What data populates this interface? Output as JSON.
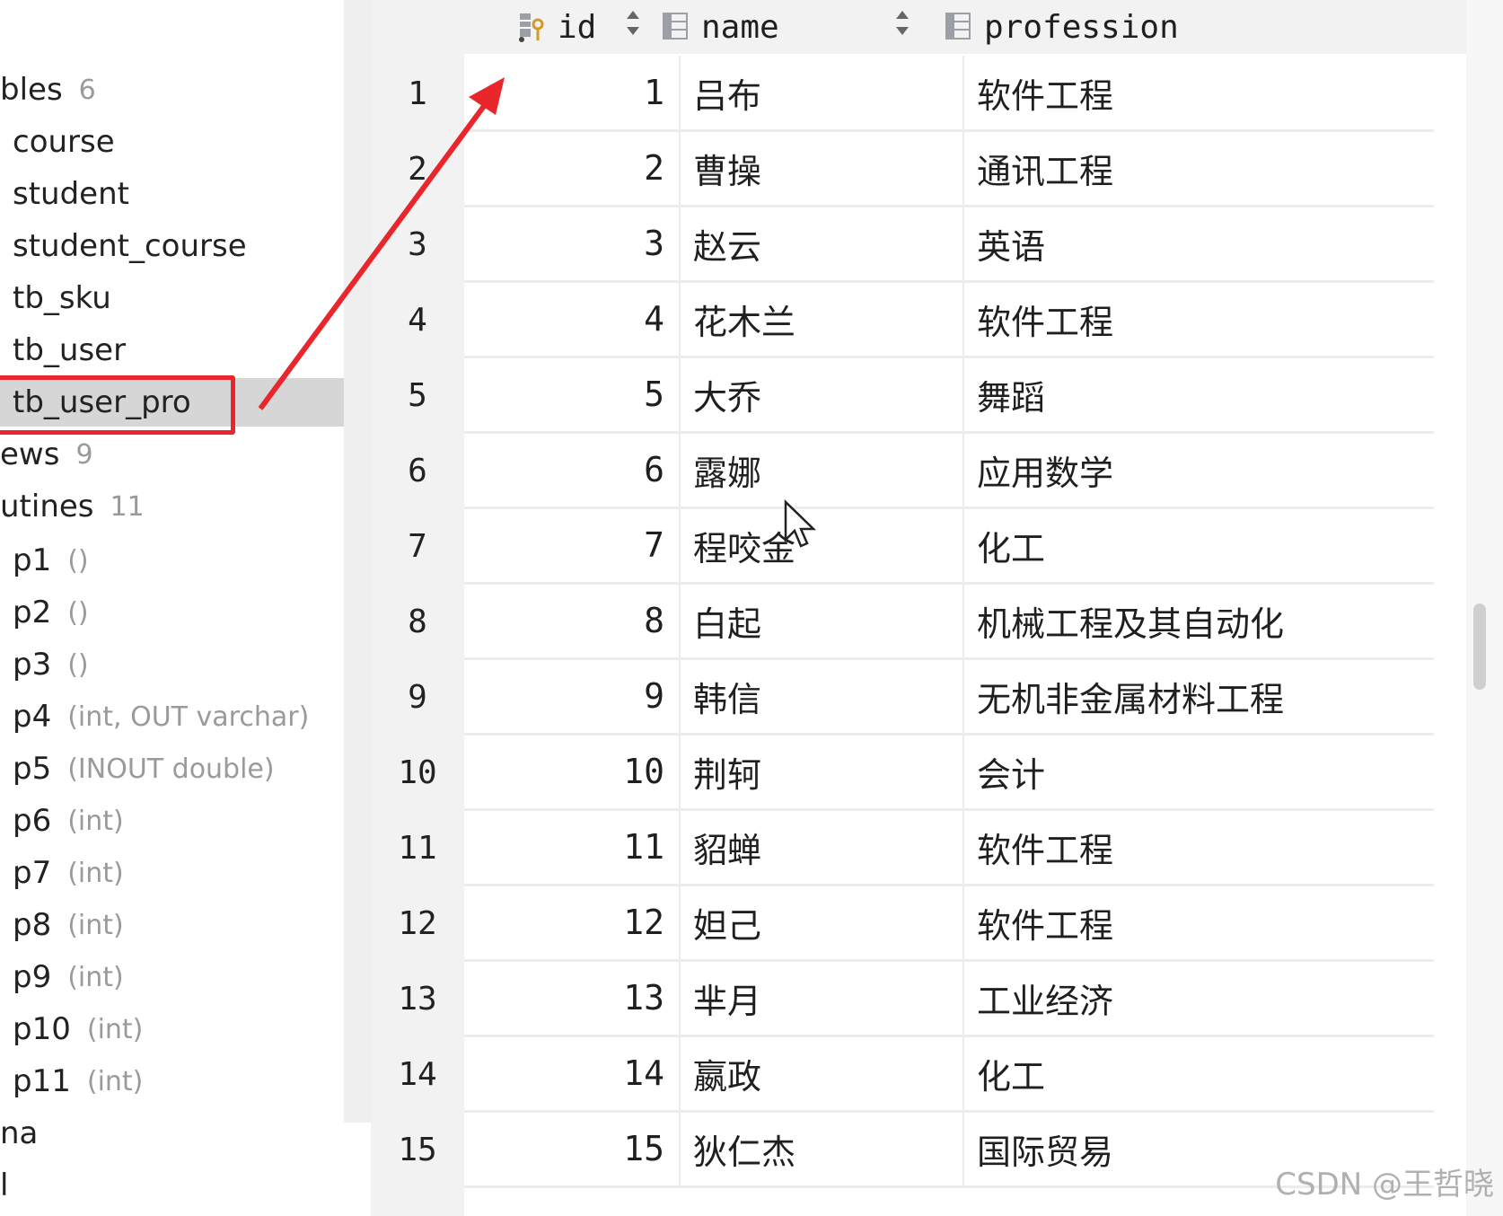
{
  "tree": {
    "items": [
      {
        "label": "bles",
        "meta": "6"
      },
      {
        "label": "course",
        "meta": ""
      },
      {
        "label": "student",
        "meta": ""
      },
      {
        "label": "student_course",
        "meta": ""
      },
      {
        "label": "tb_sku",
        "meta": ""
      },
      {
        "label": "tb_user",
        "meta": ""
      },
      {
        "label": "tb_user_pro",
        "meta": ""
      },
      {
        "label": "ews",
        "meta": "9"
      },
      {
        "label": "utines",
        "meta": "11"
      },
      {
        "label": "p1",
        "meta": "()"
      },
      {
        "label": "p2",
        "meta": "()"
      },
      {
        "label": "p3",
        "meta": "()"
      },
      {
        "label": "p4",
        "meta": "(int, OUT varchar)"
      },
      {
        "label": "p5",
        "meta": "(INOUT double)"
      },
      {
        "label": "p6",
        "meta": "(int)"
      },
      {
        "label": "p7",
        "meta": "(int)"
      },
      {
        "label": "p8",
        "meta": "(int)"
      },
      {
        "label": "p9",
        "meta": "(int)"
      },
      {
        "label": "p10",
        "meta": "(int)"
      },
      {
        "label": "p11",
        "meta": "(int)"
      },
      {
        "label": "na",
        "meta": ""
      },
      {
        "label": "l",
        "meta": ""
      }
    ]
  },
  "grid": {
    "columns": [
      {
        "name": "id",
        "icon": "primary-key-column-icon"
      },
      {
        "name": "name",
        "icon": "column-icon"
      },
      {
        "name": "profession",
        "icon": "column-icon"
      }
    ],
    "rows": [
      {
        "n": "1",
        "id": "1",
        "name": "吕布",
        "profession": "软件工程"
      },
      {
        "n": "2",
        "id": "2",
        "name": "曹操",
        "profession": "通讯工程"
      },
      {
        "n": "3",
        "id": "3",
        "name": "赵云",
        "profession": "英语"
      },
      {
        "n": "4",
        "id": "4",
        "name": "花木兰",
        "profession": "软件工程"
      },
      {
        "n": "5",
        "id": "5",
        "name": "大乔",
        "profession": "舞蹈"
      },
      {
        "n": "6",
        "id": "6",
        "name": "露娜",
        "profession": "应用数学"
      },
      {
        "n": "7",
        "id": "7",
        "name": "程咬金",
        "profession": "化工"
      },
      {
        "n": "8",
        "id": "8",
        "name": "白起",
        "profession": "机械工程及其自动化"
      },
      {
        "n": "9",
        "id": "9",
        "name": "韩信",
        "profession": "无机非金属材料工程"
      },
      {
        "n": "10",
        "id": "10",
        "name": "荆轲",
        "profession": "会计"
      },
      {
        "n": "11",
        "id": "11",
        "name": "貂蝉",
        "profession": "软件工程"
      },
      {
        "n": "12",
        "id": "12",
        "name": "妲己",
        "profession": "软件工程"
      },
      {
        "n": "13",
        "id": "13",
        "name": "芈月",
        "profession": "工业经济"
      },
      {
        "n": "14",
        "id": "14",
        "name": "嬴政",
        "profession": "化工"
      },
      {
        "n": "15",
        "id": "15",
        "name": "狄仁杰",
        "profession": "国际贸易"
      }
    ]
  },
  "annotation": {
    "color": "#e8262c"
  },
  "watermark": "CSDN @王哲晓"
}
